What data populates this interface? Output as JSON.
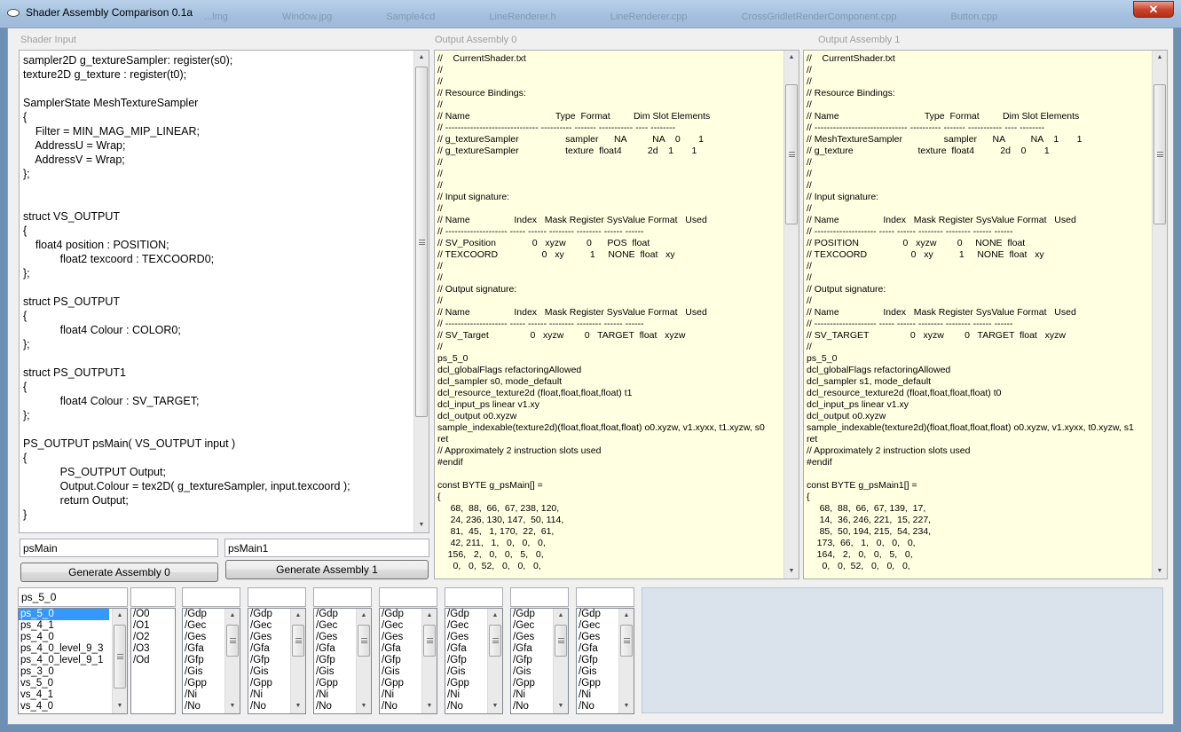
{
  "window": {
    "title": "Shader Assembly Comparison 0.1a",
    "close_label": "✕",
    "ghost_tabs": [
      "...lmg",
      "Window.jpg",
      "Sample4cd",
      "LineRenderer.h",
      "LineRenderer.cpp",
      "CrossGridletRenderComponent.cpp",
      "Button.cpp"
    ]
  },
  "shader_input": {
    "label": "Shader Input",
    "code": "sampler2D g_textureSampler: register(s0);\ntexture2D g_texture : register(t0);\n\nSamplerState MeshTextureSampler\n{\n    Filter = MIN_MAG_MIP_LINEAR;\n    AddressU = Wrap;\n    AddressV = Wrap;\n};\n\n\nstruct VS_OUTPUT\n{\n    float4 position : POSITION;\n            float2 texcoord : TEXCOORD0;\n};\n\nstruct PS_OUTPUT\n{\n            float4 Colour : COLOR0;\n};\n\nstruct PS_OUTPUT1\n{\n            float4 Colour : SV_TARGET;\n};\n\nPS_OUTPUT psMain( VS_OUTPUT input )\n{\n            PS_OUTPUT Output;\n            Output.Colour = tex2D( g_textureSampler, input.texcoord );\n            return Output;\n}"
  },
  "entry_points": {
    "entry0": "psMain",
    "entry1": "psMain1",
    "generate0_label": "Generate Assembly 0",
    "generate1_label": "Generate Assembly 1"
  },
  "output0": {
    "label": "Output Assembly 0",
    "text": "//    CurrentShader.txt\n//\n//\n// Resource Bindings:\n//\n// Name                                 Type  Format         Dim Slot Elements\n// ------------------------------ ---------- ------- ----------- ---- --------\n// g_textureSampler                  sampler      NA          NA    0       1\n// g_textureSampler                  texture  float4          2d    1       1\n//\n//\n//\n// Input signature:\n//\n// Name                 Index   Mask Register SysValue Format   Used\n// -------------------- ----- ------ -------- -------- ------ ------\n// SV_Position              0   xyzw        0      POS  float\n// TEXCOORD                 0   xy          1     NONE  float   xy\n//\n//\n// Output signature:\n//\n// Name                 Index   Mask Register SysValue Format   Used\n// -------------------- ----- ------ -------- -------- ------ ------\n// SV_Target                0   xyzw        0   TARGET  float   xyzw\n//\nps_5_0\ndcl_globalFlags refactoringAllowed\ndcl_sampler s0, mode_default\ndcl_resource_texture2d (float,float,float,float) t1\ndcl_input_ps linear v1.xy\ndcl_output o0.xyzw\nsample_indexable(texture2d)(float,float,float,float) o0.xyzw, v1.xyxx, t1.xyzw, s0\nret\n// Approximately 2 instruction slots used\n#endif\n\nconst BYTE g_psMain[] =\n{\n     68,  88,  66,  67, 238, 120,\n     24, 236, 130, 147,  50, 114,\n     81,  45,   1, 170,  22,  61,\n     42, 211,   1,   0,   0,   0,\n    156,   2,   0,   0,   5,   0,\n      0,   0,  52,   0,   0,   0,"
  },
  "output1": {
    "label": "Output Assembly 1",
    "text": "//    CurrentShader.txt\n//\n//\n// Resource Bindings:\n//\n// Name                                 Type  Format         Dim Slot Elements\n// ------------------------------ ---------- ------- ----------- ---- --------\n// MeshTextureSampler                sampler      NA          NA    1       1\n// g_texture                         texture  float4          2d    0       1\n//\n//\n//\n// Input signature:\n//\n// Name                 Index   Mask Register SysValue Format   Used\n// -------------------- ----- ------ -------- -------- ------ ------\n// POSITION                 0   xyzw        0     NONE  float\n// TEXCOORD                 0   xy          1     NONE  float   xy\n//\n//\n// Output signature:\n//\n// Name                 Index   Mask Register SysValue Format   Used\n// -------------------- ----- ------ -------- -------- ------ ------\n// SV_TARGET                0   xyzw        0   TARGET  float   xyzw\n//\nps_5_0\ndcl_globalFlags refactoringAllowed\ndcl_sampler s1, mode_default\ndcl_resource_texture2d (float,float,float,float) t0\ndcl_input_ps linear v1.xy\ndcl_output o0.xyzw\nsample_indexable(texture2d)(float,float,float,float) o0.xyzw, v1.xyxx, t0.xyzw, s1\nret\n// Approximately 2 instruction slots used\n#endif\n\nconst BYTE g_psMain1[] =\n{\n     68,  88,  66,  67, 139,  17,\n     14,  36, 246, 221,  15, 227,\n     85,  50, 194, 215,  54, 234,\n    173,  66,   1,   0,   0,   0,\n    164,   2,   0,   0,   5,   0,\n      0,   0,  52,   0,   0,   0,"
  },
  "profile": {
    "value": "ps_5_0",
    "items": [
      "ps_5_0",
      "ps_4_1",
      "ps_4_0",
      "ps_4_0_level_9_3",
      "ps_4_0_level_9_1",
      "ps_3_0",
      "vs_5_0",
      "vs_4_1",
      "vs_4_0"
    ],
    "selected_index": 0
  },
  "optimization": {
    "value": "",
    "items": [
      "/O0",
      "/O1",
      "/O2",
      "/O3",
      "/Od"
    ]
  },
  "flag_lists": [
    {
      "value": "",
      "items": [
        "/Gdp",
        "/Gec",
        "/Ges",
        "/Gfa",
        "/Gfp",
        "/Gis",
        "/Gpp",
        "/Ni",
        "/No"
      ]
    },
    {
      "value": "",
      "items": [
        "/Gdp",
        "/Gec",
        "/Ges",
        "/Gfa",
        "/Gfp",
        "/Gis",
        "/Gpp",
        "/Ni",
        "/No"
      ]
    },
    {
      "value": "",
      "items": [
        "/Gdp",
        "/Gec",
        "/Ges",
        "/Gfa",
        "/Gfp",
        "/Gis",
        "/Gpp",
        "/Ni",
        "/No"
      ]
    },
    {
      "value": "",
      "items": [
        "/Gdp",
        "/Gec",
        "/Ges",
        "/Gfa",
        "/Gfp",
        "/Gis",
        "/Gpp",
        "/Ni",
        "/No"
      ]
    },
    {
      "value": "",
      "items": [
        "/Gdp",
        "/Gec",
        "/Ges",
        "/Gfa",
        "/Gfp",
        "/Gis",
        "/Gpp",
        "/Ni",
        "/No"
      ]
    },
    {
      "value": "",
      "items": [
        "/Gdp",
        "/Gec",
        "/Ges",
        "/Gfa",
        "/Gfp",
        "/Gis",
        "/Gpp",
        "/Ni",
        "/No"
      ]
    },
    {
      "value": "",
      "items": [
        "/Gdp",
        "/Gec",
        "/Ges",
        "/Gfa",
        "/Gfp",
        "/Gis",
        "/Gpp",
        "/Ni",
        "/No"
      ]
    }
  ],
  "icons": {
    "scroll_up": "▲",
    "scroll_down": "▼"
  },
  "colors": {
    "output_bg": "#ffffe1",
    "selection": "#3399ff",
    "status_panel": "#dae3ec"
  }
}
